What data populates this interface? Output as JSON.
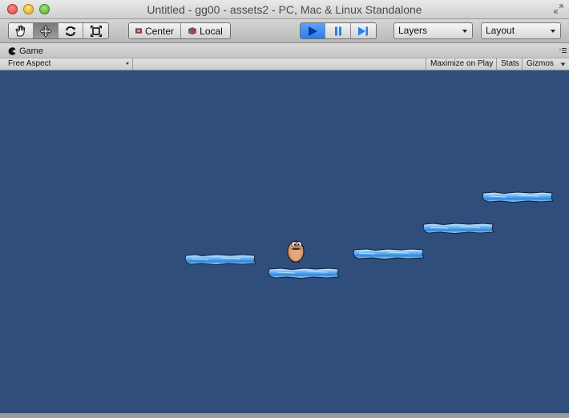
{
  "window": {
    "title": "Untitled - gg00 - assets2 - PC, Mac & Linux Standalone"
  },
  "toolbar": {
    "tools": [
      "hand-tool",
      "move-tool",
      "rotate-tool",
      "scale-tool"
    ],
    "active_tool": "move-tool",
    "pivot_label": "Center",
    "space_label": "Local",
    "play_state": "playing",
    "layers_label": "Layers",
    "layout_label": "Layout"
  },
  "game_tab": {
    "label": "Game"
  },
  "game_bar": {
    "aspect_label": "Free Aspect",
    "maximize_label": "Maximize on Play",
    "stats_label": "Stats",
    "gizmos_label": "Gizmos"
  },
  "scene": {
    "background_color": "#304e7c",
    "platform_color": "#3a8fe6",
    "objects": [
      "ice-platform",
      "ice-platform",
      "ice-platform",
      "ice-platform",
      "ice-platform",
      "player-character"
    ]
  }
}
